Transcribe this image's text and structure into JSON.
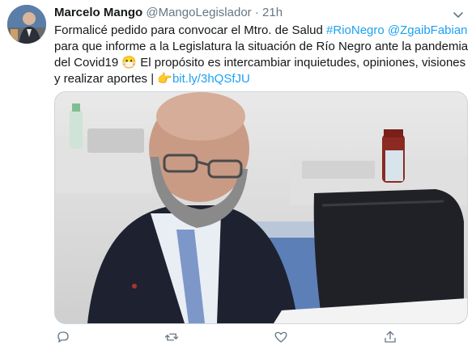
{
  "tweet": {
    "author_name": "Marcelo Mango",
    "author_handle": "@MangoLegislador",
    "separator": "·",
    "time": "21h",
    "text_lines": [
      [
        "Formalicé pedido para convocar el Mtro. de Salud ",
        "#RioNegro",
        " ",
        "@ZgaibFabian"
      ],
      [
        "para que informe a la Legislatura la situación de Río Negro ante la pandemia"
      ],
      [
        "del Covid19 ",
        "😷",
        " El propósito es intercambiar inquietudes, opiniones, visiones"
      ],
      [
        "y realizar aportes | ",
        "👉",
        "bit.ly/3hQSfJU"
      ]
    ],
    "text_segments": {
      "l1a": "Formalicé pedido para convocar el Mtro. de Salud ",
      "l1b": "#RioNegro",
      "l1c": " ",
      "l1d": "@ZgaibFabian",
      "l2": "para que informe a la Legislatura la situación de Río Negro ante la pandemia",
      "l3a": "del Covid19 ",
      "l3b": "😷",
      "l3c": " El propósito es intercambiar inquietudes, opiniones, visiones",
      "l4a": "y realizar aportes | ",
      "l4b": "👉",
      "l4c": "bit.ly/3hQSfJU"
    },
    "link_color": "#1da1f2"
  },
  "icons": {
    "caret": "chevron-down-icon",
    "reply": "reply-icon",
    "retweet": "retweet-icon",
    "like": "heart-icon",
    "share": "share-icon"
  }
}
